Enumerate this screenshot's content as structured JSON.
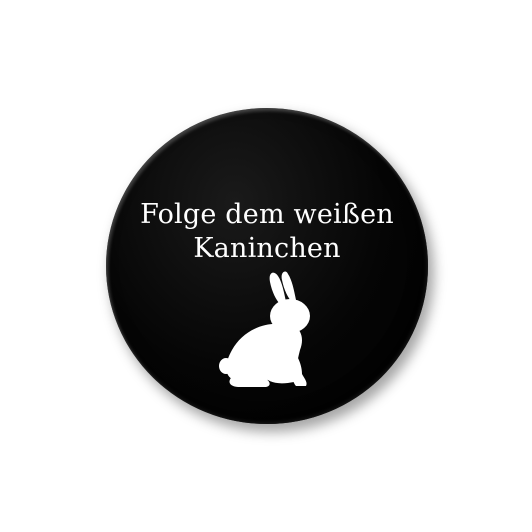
{
  "badge": {
    "text_line_1": "Folge dem weißen",
    "text_line_2": "Kaninchen",
    "icon": "rabbit-icon",
    "colors": {
      "badge": "#000000",
      "text": "#ffffff",
      "background": "#ffffff"
    }
  }
}
